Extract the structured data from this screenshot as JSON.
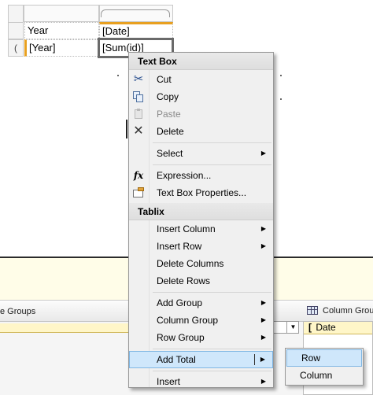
{
  "tablix": {
    "year_label": "Year",
    "date_field": "[Date]",
    "year_field": "[Year]",
    "sum_field": "[Sum(id)]",
    "row_handle_glyph": "("
  },
  "context_menu": {
    "textbox_section": "Text Box",
    "cut": "Cut",
    "copy": "Copy",
    "paste": "Paste",
    "delete": "Delete",
    "select": "Select",
    "expression": "Expression...",
    "textbox_properties": "Text Box Properties...",
    "tablix_section": "Tablix",
    "insert_column": "Insert Column",
    "insert_row": "Insert Row",
    "delete_columns": "Delete Columns",
    "delete_rows": "Delete Rows",
    "add_group": "Add Group",
    "column_group": "Column Group",
    "row_group": "Row Group",
    "add_total": "Add Total",
    "insert": "Insert",
    "arrow_glyph": "▶"
  },
  "submenu": {
    "row": "Row",
    "column": "Column"
  },
  "groups_pane": {
    "row_groups_label": "e Groups",
    "column_groups_label": "Column Grou",
    "column_group_item": "Date",
    "column_group_bracket": "[",
    "dropdown_glyph": "▼"
  },
  "icons": {
    "cut": "scissors-icon",
    "copy": "copy-icon",
    "paste": "paste-icon",
    "delete": "delete-icon",
    "expression": "fx-icon",
    "properties": "textbox-properties-icon",
    "fx_glyph": "fx",
    "delete_glyph": "✕",
    "scissors_glyph": "✂"
  },
  "colors": {
    "menu_background": "#f0f0f0",
    "highlight": "#cfe7fb",
    "highlight_border": "#7fb6e3",
    "selection_orange": "#e8a020",
    "yellow_band": "#fffde8"
  }
}
